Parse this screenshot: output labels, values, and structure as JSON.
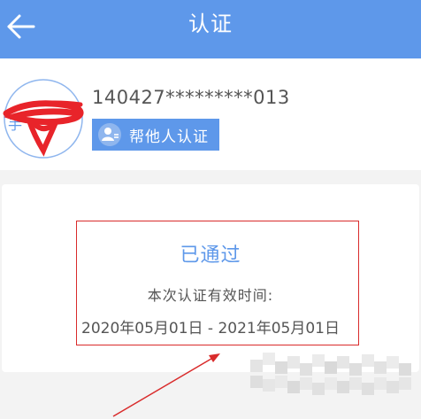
{
  "header": {
    "title": "认证",
    "back_icon": "back-arrow-icon"
  },
  "user": {
    "id_number": "140427*********013",
    "help_button_label": "帮他人认证",
    "help_button_icon": "user-icon"
  },
  "verification": {
    "status": "已通过",
    "validity_label": "本次认证有效时间:",
    "validity_range": "2020年05月01日 - 2021年05月01日"
  },
  "colors": {
    "brand_blue": "#5e98ea",
    "annotation_red": "#d92b2b",
    "page_background": "#f3f3f3"
  }
}
